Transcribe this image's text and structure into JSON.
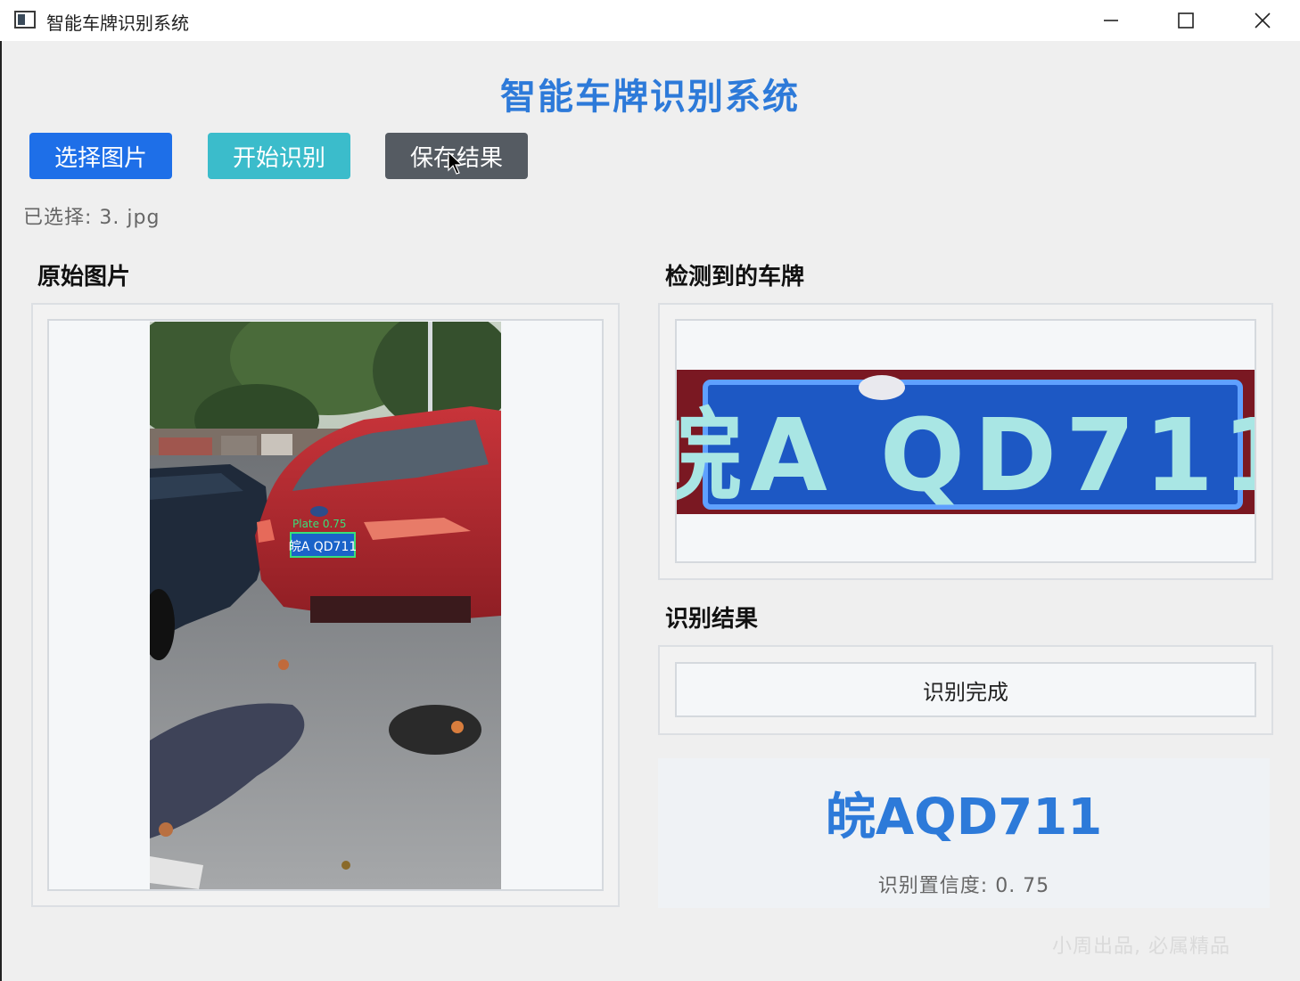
{
  "window": {
    "title": "智能车牌识别系统",
    "icon": "app-window-icon",
    "controls": [
      "minimize-icon",
      "maximize-icon",
      "close-icon"
    ]
  },
  "header": {
    "title": "智能车牌识别系统",
    "color": "#2d7ad9"
  },
  "toolbar": {
    "select_label": "选择图片",
    "start_label": "开始识别",
    "save_label": "保存结果",
    "colors": {
      "select": "#1e6fe8",
      "start": "#3bbccb",
      "save": "#555b62"
    }
  },
  "file": {
    "selected_text": "已选择: 3. jpg"
  },
  "panels": {
    "original_title": "原始图片",
    "detected_title": "检测到的车牌",
    "result_title": "识别结果"
  },
  "detection": {
    "overlay_label": "Plate 0.75",
    "plate_text_small": "皖A QD711"
  },
  "result": {
    "status": "识别完成",
    "plate_number": "皖AQD711",
    "confidence_text": "识别置信度: 0. 75",
    "confidence_value": 0.75,
    "plate_color": "#2d7ad9"
  },
  "watermark": "小周出品, 必属精品"
}
